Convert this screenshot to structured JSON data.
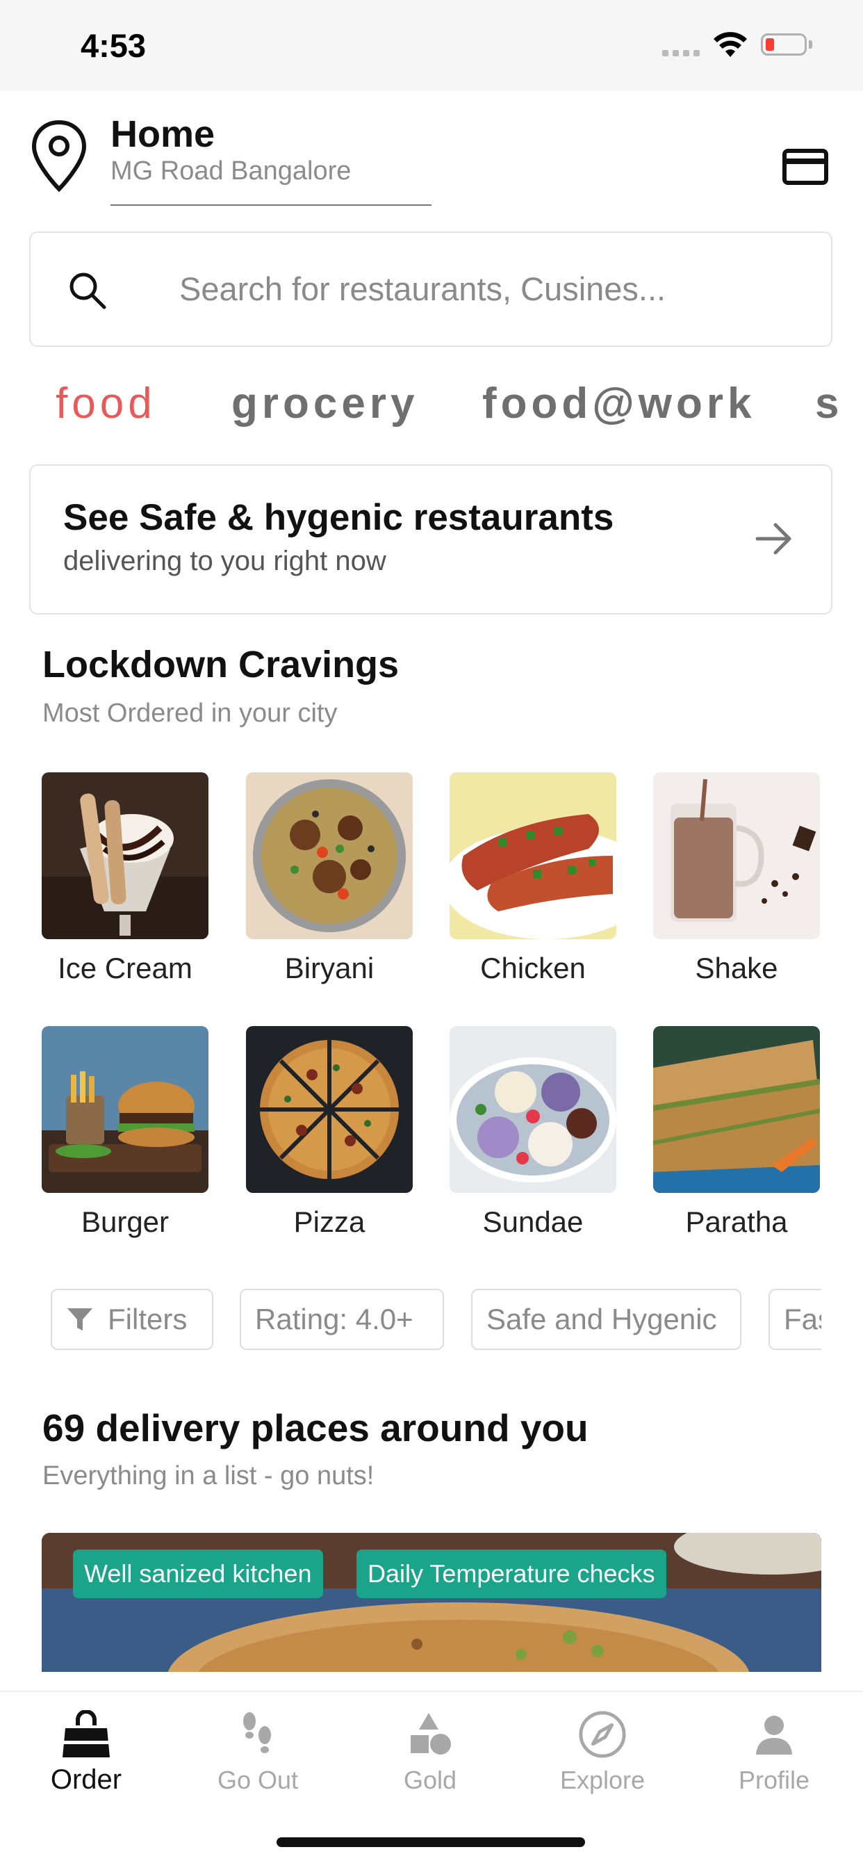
{
  "status_bar": {
    "time": "4:53"
  },
  "header": {
    "location_title": "Home",
    "location_subtitle": "MG Road Bangalore",
    "pin_icon": "location-pin-icon",
    "card_icon": "credit-card-icon"
  },
  "search": {
    "placeholder": "Search for restaurants, Cusines..."
  },
  "categories": [
    "food",
    "grocery",
    "food@work",
    "s"
  ],
  "banner": {
    "title": "See Safe & hygenic restaurants",
    "subtitle": "delivering to you right now"
  },
  "cravings": {
    "title": "Lockdown Cravings",
    "subtitle": "Most Ordered in your city",
    "items": [
      {
        "label": "Ice Cream"
      },
      {
        "label": "Biryani"
      },
      {
        "label": "Chicken"
      },
      {
        "label": "Shake"
      },
      {
        "label": "Burger"
      },
      {
        "label": "Pizza"
      },
      {
        "label": "Sundae"
      },
      {
        "label": "Paratha"
      }
    ]
  },
  "filters": {
    "filter_label": "Filters",
    "rating_label": "Rating:  4.0+",
    "safe_label": "Safe and Hygenic",
    "fast_label": "Fast Delivery"
  },
  "delivery": {
    "title": "69 delivery places around you",
    "subtitle": "Everything in a list - go nuts!",
    "tags": [
      "Well sanized kitchen",
      "Daily Temperature checks"
    ]
  },
  "tabbar": {
    "items": [
      {
        "label": "Order",
        "icon": "shopping-bag-icon"
      },
      {
        "label": "Go Out",
        "icon": "footsteps-icon"
      },
      {
        "label": "Gold",
        "icon": "shapes-icon"
      },
      {
        "label": "Explore",
        "icon": "compass-icon"
      },
      {
        "label": "Profile",
        "icon": "person-icon"
      }
    ]
  },
  "colors": {
    "accent": "#e85a5a",
    "tag_green": "#1aa48a",
    "muted_text": "#8b8b8b"
  }
}
